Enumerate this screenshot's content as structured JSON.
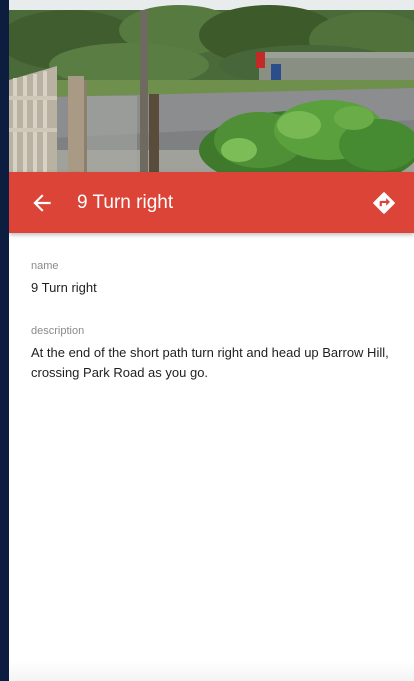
{
  "hero": {
    "description": "photo"
  },
  "appbar": {
    "back_icon": "arrow-left-icon",
    "title": "9 Turn right",
    "directions_icon": "directions-icon",
    "color": "#db4437"
  },
  "fields": {
    "name_label": "name",
    "name_value": "9 Turn right",
    "description_label": "description",
    "description_value": "At the end of the short path turn right and head up Barrow Hill, crossing Park Road as you go."
  }
}
